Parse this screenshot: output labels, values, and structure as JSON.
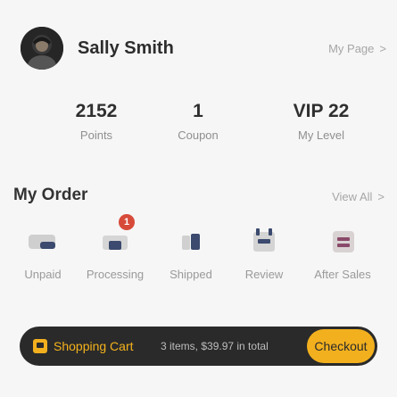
{
  "header": {
    "user_name": "Sally Smith",
    "my_page_label": "My Page",
    "chevron": ">"
  },
  "stats": [
    {
      "value": "2152",
      "label": "Points"
    },
    {
      "value": "1",
      "label": "Coupon"
    },
    {
      "value": "VIP 22",
      "label": "My Level"
    }
  ],
  "orders": {
    "title": "My Order",
    "view_all_label": "View All",
    "chevron": ">",
    "items": [
      {
        "label": "Unpaid",
        "icon": "wallet-icon"
      },
      {
        "label": "Processing",
        "icon": "box-icon",
        "badge": "1"
      },
      {
        "label": "Shipped",
        "icon": "truck-icon"
      },
      {
        "label": "Review",
        "icon": "chat-icon"
      },
      {
        "label": "After Sales",
        "icon": "refund-icon"
      }
    ]
  },
  "cart": {
    "label": "Shopping Cart",
    "summary": "3 items, $39.97 in total",
    "checkout_label": "Checkout"
  },
  "colors": {
    "accent": "#f2b01e",
    "badge": "#d74a3a",
    "cart_bar": "#2a2a2a"
  }
}
